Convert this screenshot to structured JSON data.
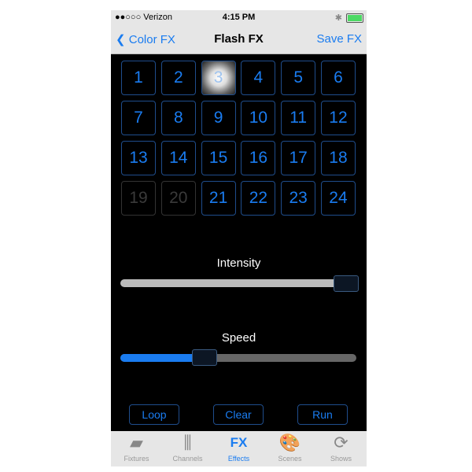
{
  "status": {
    "carrier": "●●○○○ Verizon",
    "time": "4:15 PM",
    "battery_level": 100
  },
  "nav": {
    "back_label": "Color FX",
    "title": "Flash FX",
    "save_label": "Save FX"
  },
  "grid": {
    "cells": [
      {
        "label": "1",
        "state": "normal"
      },
      {
        "label": "2",
        "state": "normal"
      },
      {
        "label": "3",
        "state": "active"
      },
      {
        "label": "4",
        "state": "normal"
      },
      {
        "label": "5",
        "state": "normal"
      },
      {
        "label": "6",
        "state": "normal"
      },
      {
        "label": "7",
        "state": "normal"
      },
      {
        "label": "8",
        "state": "normal"
      },
      {
        "label": "9",
        "state": "normal"
      },
      {
        "label": "10",
        "state": "normal"
      },
      {
        "label": "11",
        "state": "normal"
      },
      {
        "label": "12",
        "state": "normal"
      },
      {
        "label": "13",
        "state": "normal"
      },
      {
        "label": "14",
        "state": "normal"
      },
      {
        "label": "15",
        "state": "normal"
      },
      {
        "label": "16",
        "state": "normal"
      },
      {
        "label": "17",
        "state": "normal"
      },
      {
        "label": "18",
        "state": "normal"
      },
      {
        "label": "19",
        "state": "disabled"
      },
      {
        "label": "20",
        "state": "disabled"
      },
      {
        "label": "21",
        "state": "normal"
      },
      {
        "label": "22",
        "state": "normal"
      },
      {
        "label": "23",
        "state": "normal"
      },
      {
        "label": "24",
        "state": "normal"
      }
    ]
  },
  "intensity": {
    "label": "Intensity",
    "value": 1.0
  },
  "speed": {
    "label": "Speed",
    "value": 0.35
  },
  "buttons": {
    "loop": "Loop",
    "clear": "Clear",
    "run": "Run"
  },
  "tabs": [
    {
      "label": "Fixtures",
      "icon": "fixture-icon"
    },
    {
      "label": "Channels",
      "icon": "sliders-icon"
    },
    {
      "label": "Effects",
      "icon": "fx-icon",
      "selected": true
    },
    {
      "label": "Scenes",
      "icon": "palette-icon"
    },
    {
      "label": "Shows",
      "icon": "cycle-icon"
    }
  ],
  "colors": {
    "accent": "#1a7cf0",
    "background": "#000000",
    "bar": "#e6e6e6"
  }
}
